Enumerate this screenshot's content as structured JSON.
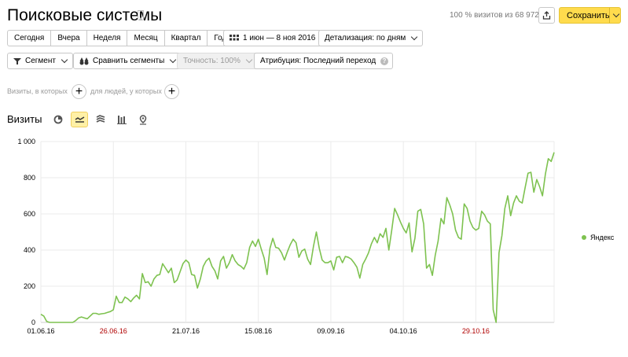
{
  "header": {
    "title": "Поисковые системы",
    "visits_info": "100 % визитов из 68 972",
    "save_label": "Сохранить"
  },
  "period_tabs": [
    "Сегодня",
    "Вчера",
    "Неделя",
    "Месяц",
    "Квартал",
    "Год"
  ],
  "date_range": "1 июн — 8 ноя 2016",
  "detail": "Детализация: по дням",
  "filters": {
    "segment": "Сегмент",
    "compare": "Сравнить сегменты",
    "accuracy": "Точность: 100%",
    "attribution": "Атрибуция: Последний переход",
    "help": "?"
  },
  "conditions": {
    "visits_where": "Визиты, в которых",
    "people_where": "для людей, у которых"
  },
  "chart_header": {
    "title": "Визиты",
    "views": [
      "pie-view-icon",
      "line-view-icon",
      "area-view-icon",
      "bar-view-icon",
      "map-view-icon"
    ],
    "active_view": 1
  },
  "chart_data": {
    "type": "line",
    "title": "",
    "xlabel": "",
    "ylabel": "",
    "ylim": [
      0,
      1000
    ],
    "y_ticks": [
      "0",
      "200",
      "400",
      "600",
      "800",
      "1 000"
    ],
    "x_ticks": [
      {
        "label": "01.06.16",
        "day": 0,
        "weekend": false
      },
      {
        "label": "26.06.16",
        "day": 25,
        "weekend": true
      },
      {
        "label": "21.07.16",
        "day": 50,
        "weekend": false
      },
      {
        "label": "15.08.16",
        "day": 75,
        "weekend": false
      },
      {
        "label": "09.09.16",
        "day": 100,
        "weekend": false
      },
      {
        "label": "04.10.16",
        "day": 125,
        "weekend": false
      },
      {
        "label": "29.10.16",
        "day": 150,
        "weekend": true
      }
    ],
    "x_start": "2016-06-01",
    "x_end": "2016-11-08",
    "color": "#7ec250",
    "series": [
      {
        "name": "Яндекс",
        "values": [
          45,
          35,
          5,
          0,
          0,
          0,
          0,
          0,
          0,
          0,
          0,
          0,
          10,
          25,
          30,
          25,
          20,
          35,
          50,
          50,
          45,
          48,
          50,
          55,
          60,
          70,
          145,
          110,
          110,
          140,
          130,
          115,
          135,
          150,
          130,
          270,
          220,
          225,
          200,
          240,
          260,
          265,
          325,
          300,
          275,
          300,
          220,
          235,
          280,
          325,
          345,
          330,
          265,
          260,
          190,
          240,
          310,
          340,
          355,
          310,
          285,
          240,
          340,
          365,
          300,
          330,
          375,
          340,
          320,
          310,
          295,
          330,
          415,
          450,
          420,
          460,
          405,
          355,
          265,
          410,
          465,
          415,
          410,
          385,
          345,
          390,
          430,
          460,
          440,
          360,
          395,
          405,
          350,
          320,
          420,
          500,
          410,
          345,
          330,
          330,
          340,
          290,
          360,
          365,
          330,
          365,
          360,
          350,
          330,
          305,
          245,
          320,
          350,
          385,
          435,
          470,
          440,
          490,
          470,
          520,
          400,
          510,
          630,
          595,
          555,
          520,
          495,
          550,
          390,
          465,
          615,
          625,
          545,
          300,
          320,
          260,
          370,
          450,
          575,
          545,
          690,
          650,
          600,
          510,
          470,
          460,
          655,
          630,
          560,
          525,
          510,
          520,
          615,
          595,
          560,
          545,
          70,
          0,
          385,
          480,
          630,
          700,
          590,
          660,
          700,
          670,
          660,
          745,
          825,
          830,
          720,
          790,
          750,
          700,
          820,
          905,
          890,
          940
        ]
      }
    ]
  }
}
